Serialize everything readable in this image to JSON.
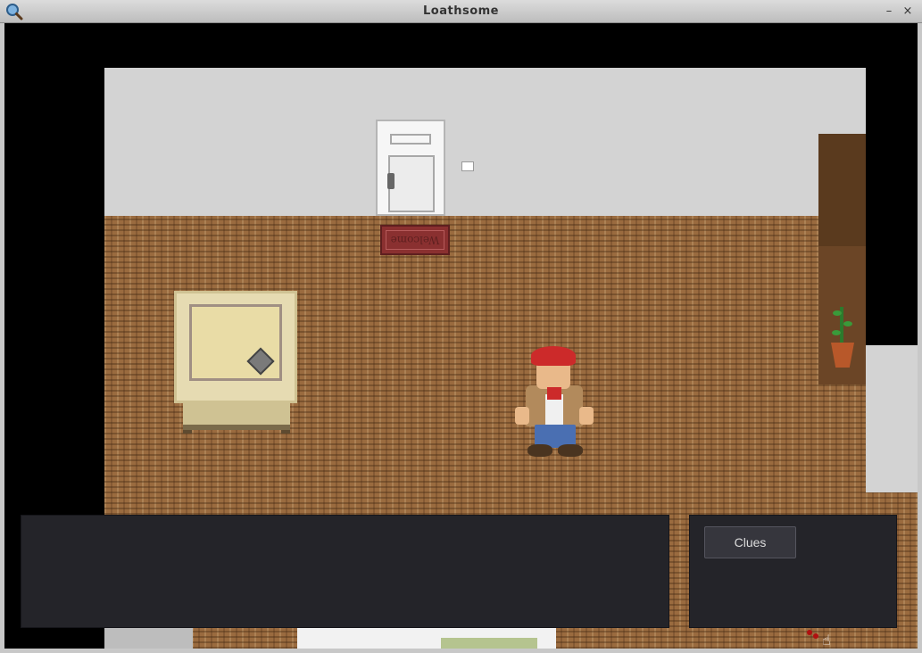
{
  "window": {
    "title": "Loathsome",
    "app_icon": "magnifier-icon",
    "minimize_glyph": "–",
    "close_glyph": "×"
  },
  "scene": {
    "door_mat_text": "Welcome",
    "colors": {
      "wall": "#d3d3d3",
      "carpet": "#9a6b3f",
      "panel": "#242429",
      "hat": "#cc2a2a"
    }
  },
  "hud": {
    "clues_button_label": "Clues"
  }
}
